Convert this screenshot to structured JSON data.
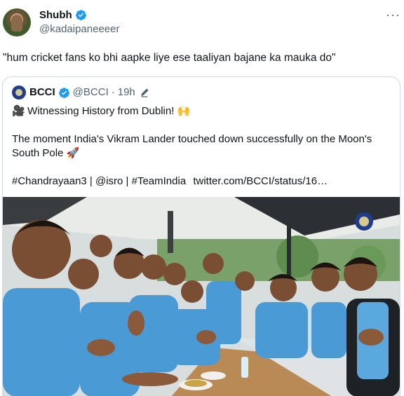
{
  "tweet": {
    "author_name": "Shubh",
    "handle": "@kadaipaneeeer",
    "text": "\"hum cricket fans ko bhi aapke liye ese taaliyan bajane ka mauka do\"",
    "more_glyph": "···"
  },
  "quote": {
    "author_name": "BCCI",
    "handle": "@BCCI",
    "separator": "·",
    "time": "19h",
    "line1_emoji": "🎥",
    "line1": "Witnessing History from Dublin!",
    "line1_end_emoji": "🙌",
    "line2": "The moment India's Vikram Lander touched down successfully on the Moon's",
    "line3": "South Pole",
    "line3_emoji": "🚀",
    "hashtags": "#Chandrayaan3 | @isro | #TeamIndia",
    "link": "twitter.com/BCCI/status/16…"
  },
  "colors": {
    "verified_blue": "#1d9bf0",
    "text": "#0f1419",
    "secondary": "#536471",
    "border": "#cfd9de",
    "jersey_blue": "#4a9ad6"
  },
  "icons": [
    "verified-badge-icon",
    "more-options-icon",
    "bcci-logo",
    "edited-pencil-icon",
    "camera-emoji",
    "raised-hands-emoji",
    "rocket-emoji"
  ]
}
